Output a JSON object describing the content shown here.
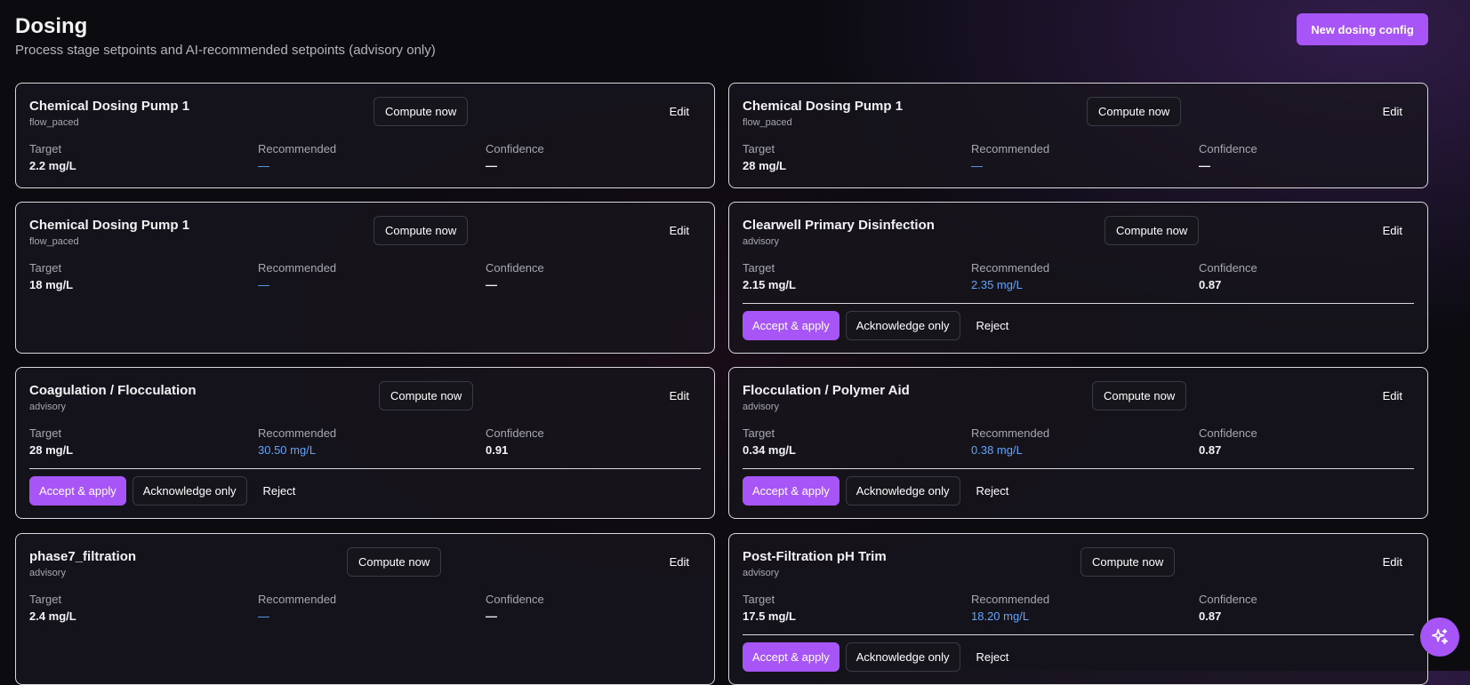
{
  "page": {
    "title": "Dosing",
    "subtitle": "Process stage setpoints and AI-recommended setpoints (advisory only)",
    "new_button": "New dosing config"
  },
  "labels": {
    "compute": "Compute now",
    "edit": "Edit",
    "target": "Target",
    "recommended": "Recommended",
    "confidence": "Confidence",
    "accept": "Accept & apply",
    "acknowledge": "Acknowledge only",
    "reject": "Reject"
  },
  "cards": [
    {
      "name": "Chemical Dosing Pump 1",
      "mode": "flow_paced",
      "target": "2.2 mg/L",
      "recommended": "—",
      "confidence": "—"
    },
    {
      "name": "Chemical Dosing Pump 1",
      "mode": "flow_paced",
      "target": "28 mg/L",
      "recommended": "—",
      "confidence": "—"
    },
    {
      "name": "Chemical Dosing Pump 1",
      "mode": "flow_paced",
      "target": "18 mg/L",
      "recommended": "—",
      "confidence": "—"
    },
    {
      "name": "Clearwell Primary Disinfection",
      "mode": "advisory",
      "target": "2.15 mg/L",
      "recommended": "2.35 mg/L",
      "confidence": "0.87"
    },
    {
      "name": "Coagulation / Flocculation",
      "mode": "advisory",
      "target": "28 mg/L",
      "recommended": "30.50 mg/L",
      "confidence": "0.91"
    },
    {
      "name": "Flocculation / Polymer Aid",
      "mode": "advisory",
      "target": "0.34 mg/L",
      "recommended": "0.38 mg/L",
      "confidence": "0.87"
    },
    {
      "name": "phase7_filtration",
      "mode": "advisory",
      "target": "2.4 mg/L",
      "recommended": "—",
      "confidence": "—"
    },
    {
      "name": "Post-Filtration pH Trim",
      "mode": "advisory",
      "target": "17.5 mg/L",
      "recommended": "18.20 mg/L",
      "confidence": "0.87"
    }
  ],
  "colors": {
    "accent": "#a855f7",
    "link": "#60a5fa"
  },
  "fab_icon": "sparkles-icon"
}
